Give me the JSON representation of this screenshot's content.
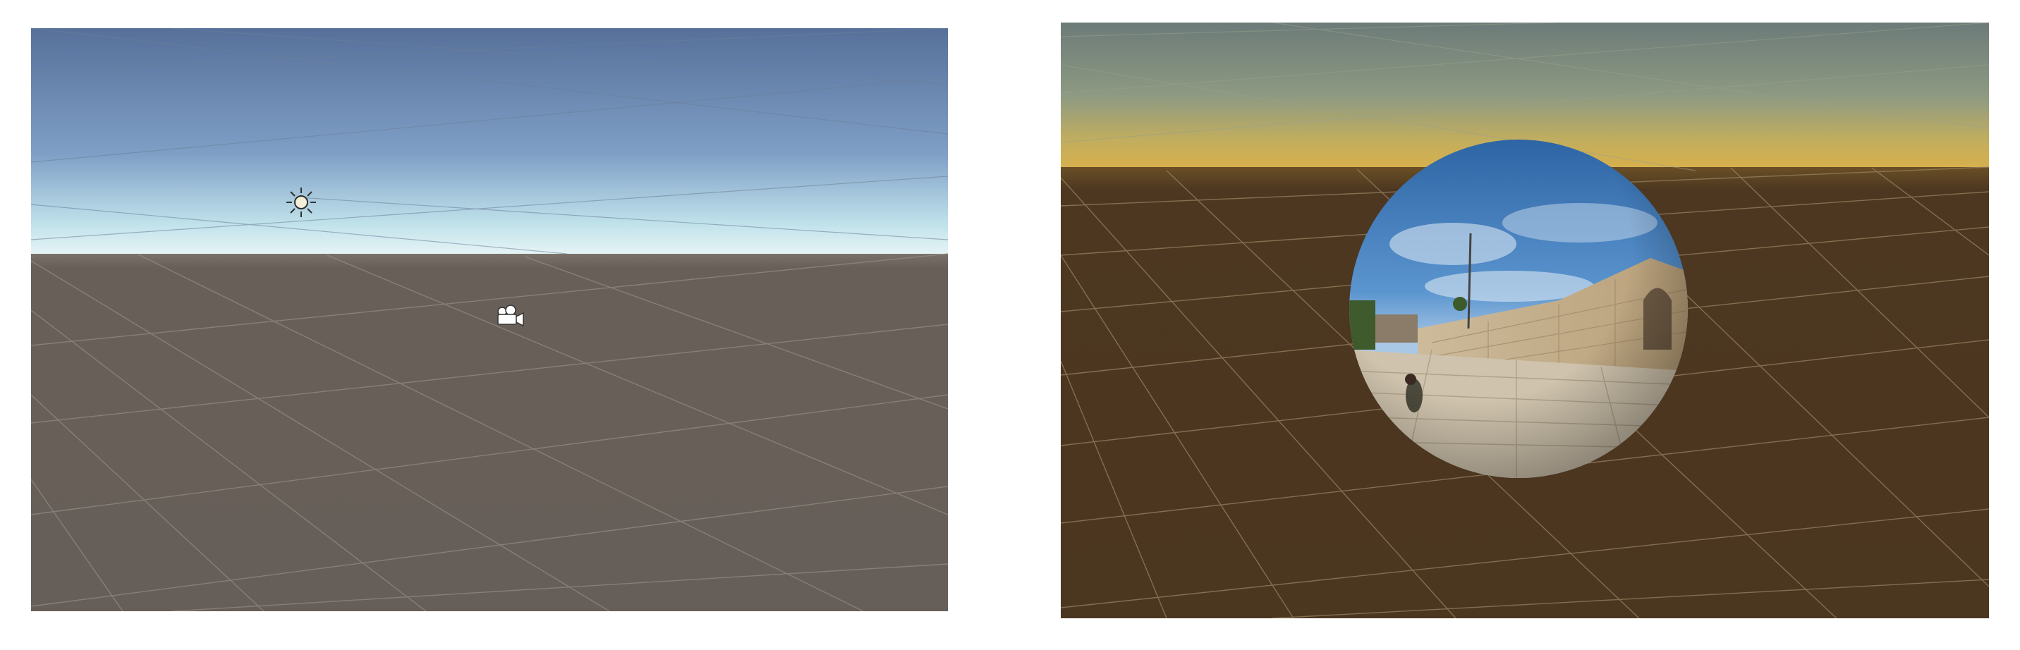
{
  "panels": [
    {
      "id": "left",
      "description_tag": "scene-view-default-skybox",
      "colors": {
        "sky_top": "#56709a",
        "sky_mid": "#7f9fc6",
        "horizon": "#e6f3f6",
        "ground": "#665e58",
        "grid": "#8a8580"
      },
      "gizmos": [
        "sun-icon",
        "camera-icon"
      ]
    },
    {
      "id": "right",
      "description_tag": "scene-view-photo-sphere",
      "colors": {
        "sky_top": "#6c7b79",
        "sky_mid": "#9aa589",
        "horizon": "#d9b04a",
        "ground": "#4b3620",
        "grid": "#8e7a5c"
      },
      "objects": [
        "panorama-sphere"
      ]
    }
  ]
}
